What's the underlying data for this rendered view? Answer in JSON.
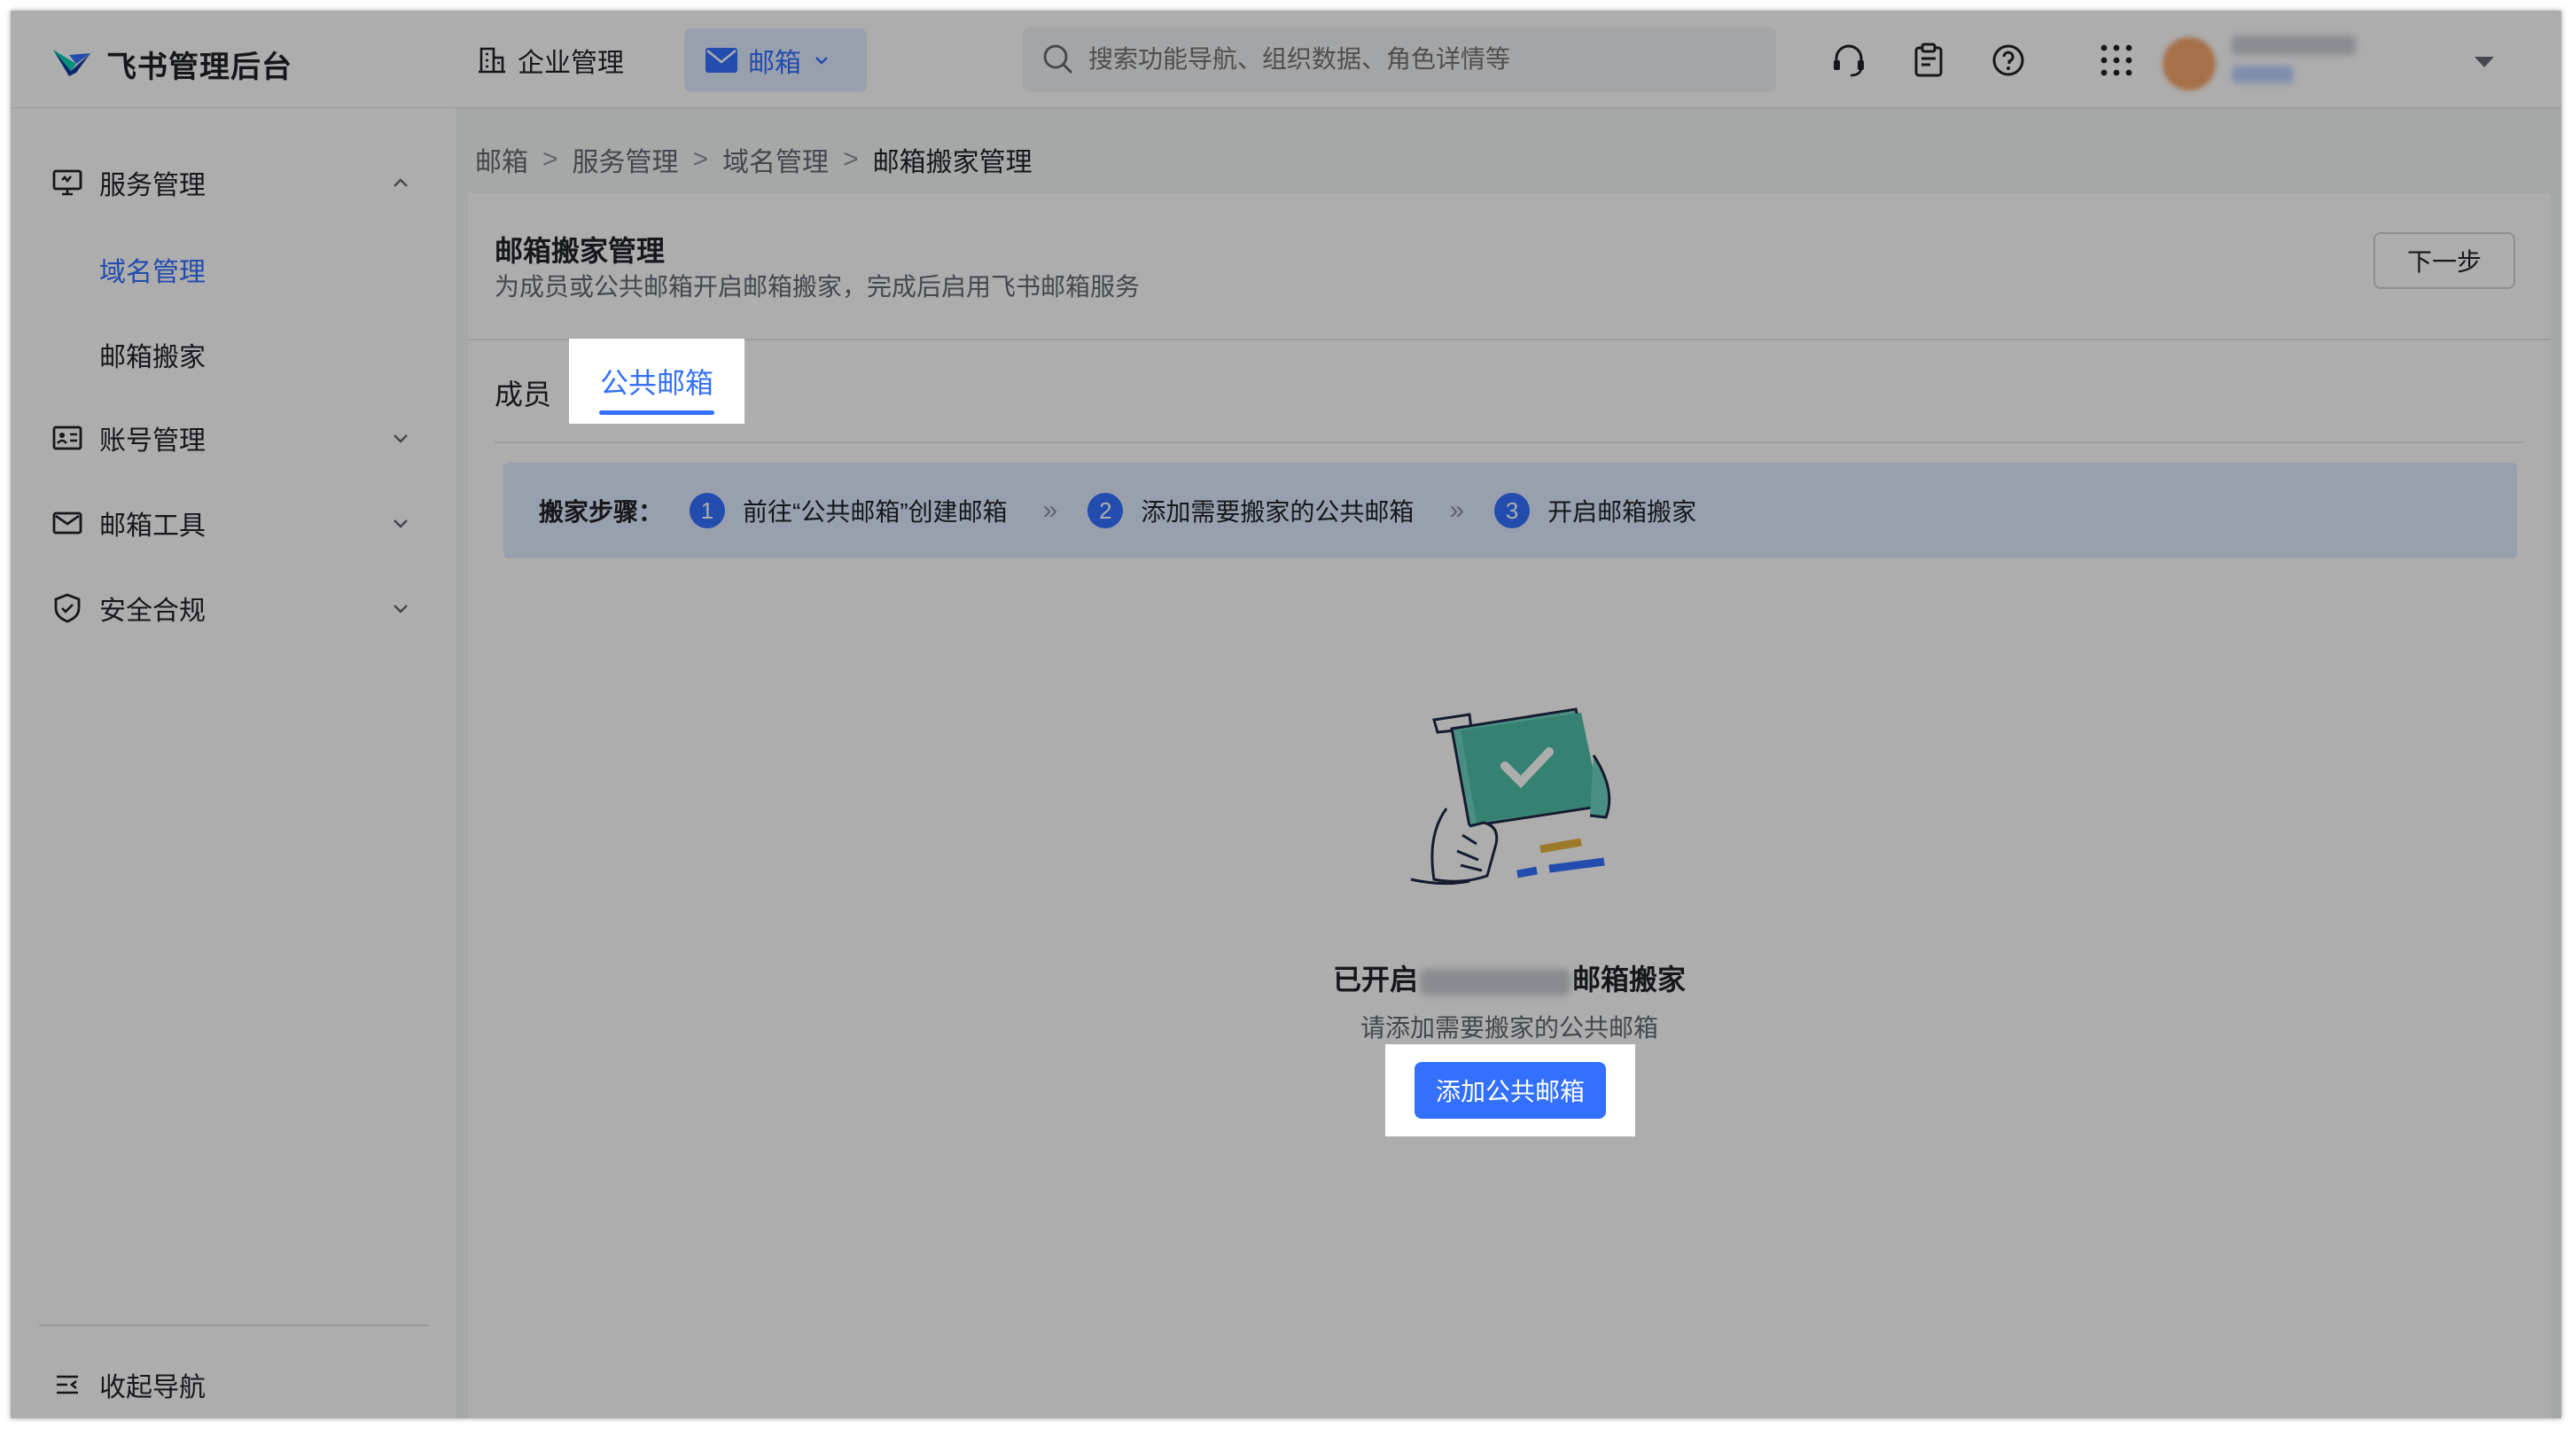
{
  "header": {
    "app_title": "飞书管理后台",
    "enterprise_label": "企业管理",
    "mail_label": "邮箱",
    "search_placeholder": "搜索功能导航、组织数据、角色详情等"
  },
  "sidebar": {
    "sections": [
      {
        "label": "服务管理",
        "expanded": true,
        "icon": "service-monitor-icon",
        "children": [
          "域名管理",
          "邮箱搬家"
        ]
      },
      {
        "label": "账号管理",
        "expanded": false,
        "icon": "id-card-icon"
      },
      {
        "label": "邮箱工具",
        "expanded": false,
        "icon": "envelope-icon"
      },
      {
        "label": "安全合规",
        "expanded": false,
        "icon": "shield-icon"
      }
    ],
    "active_child": "域名管理",
    "collapse_label": "收起导航"
  },
  "breadcrumb": [
    "邮箱",
    "服务管理",
    "域名管理",
    "邮箱搬家管理"
  ],
  "page": {
    "title": "邮箱搬家管理",
    "subtitle": "为成员或公共邮箱开启邮箱搬家，完成后启用飞书邮箱服务",
    "next_label": "下一步",
    "tabs": [
      "成员",
      "公共邮箱"
    ],
    "active_tab": "公共邮箱",
    "steps_lead": "搬家步骤：",
    "steps": [
      {
        "num": "1",
        "text": "前往“公共邮箱”创建邮箱"
      },
      {
        "num": "2",
        "text": "添加需要搬家的公共邮箱"
      },
      {
        "num": "3",
        "text": "开启邮箱搬家"
      }
    ],
    "empty_title_prefix": "已开启",
    "empty_title_suffix": "邮箱搬家",
    "empty_subtitle": "请添加需要搬家的公共邮箱",
    "add_button": "添加公共邮箱"
  },
  "colors": {
    "accent": "#3370ff",
    "overlay": "rgba(0,0,0,0.32)"
  }
}
